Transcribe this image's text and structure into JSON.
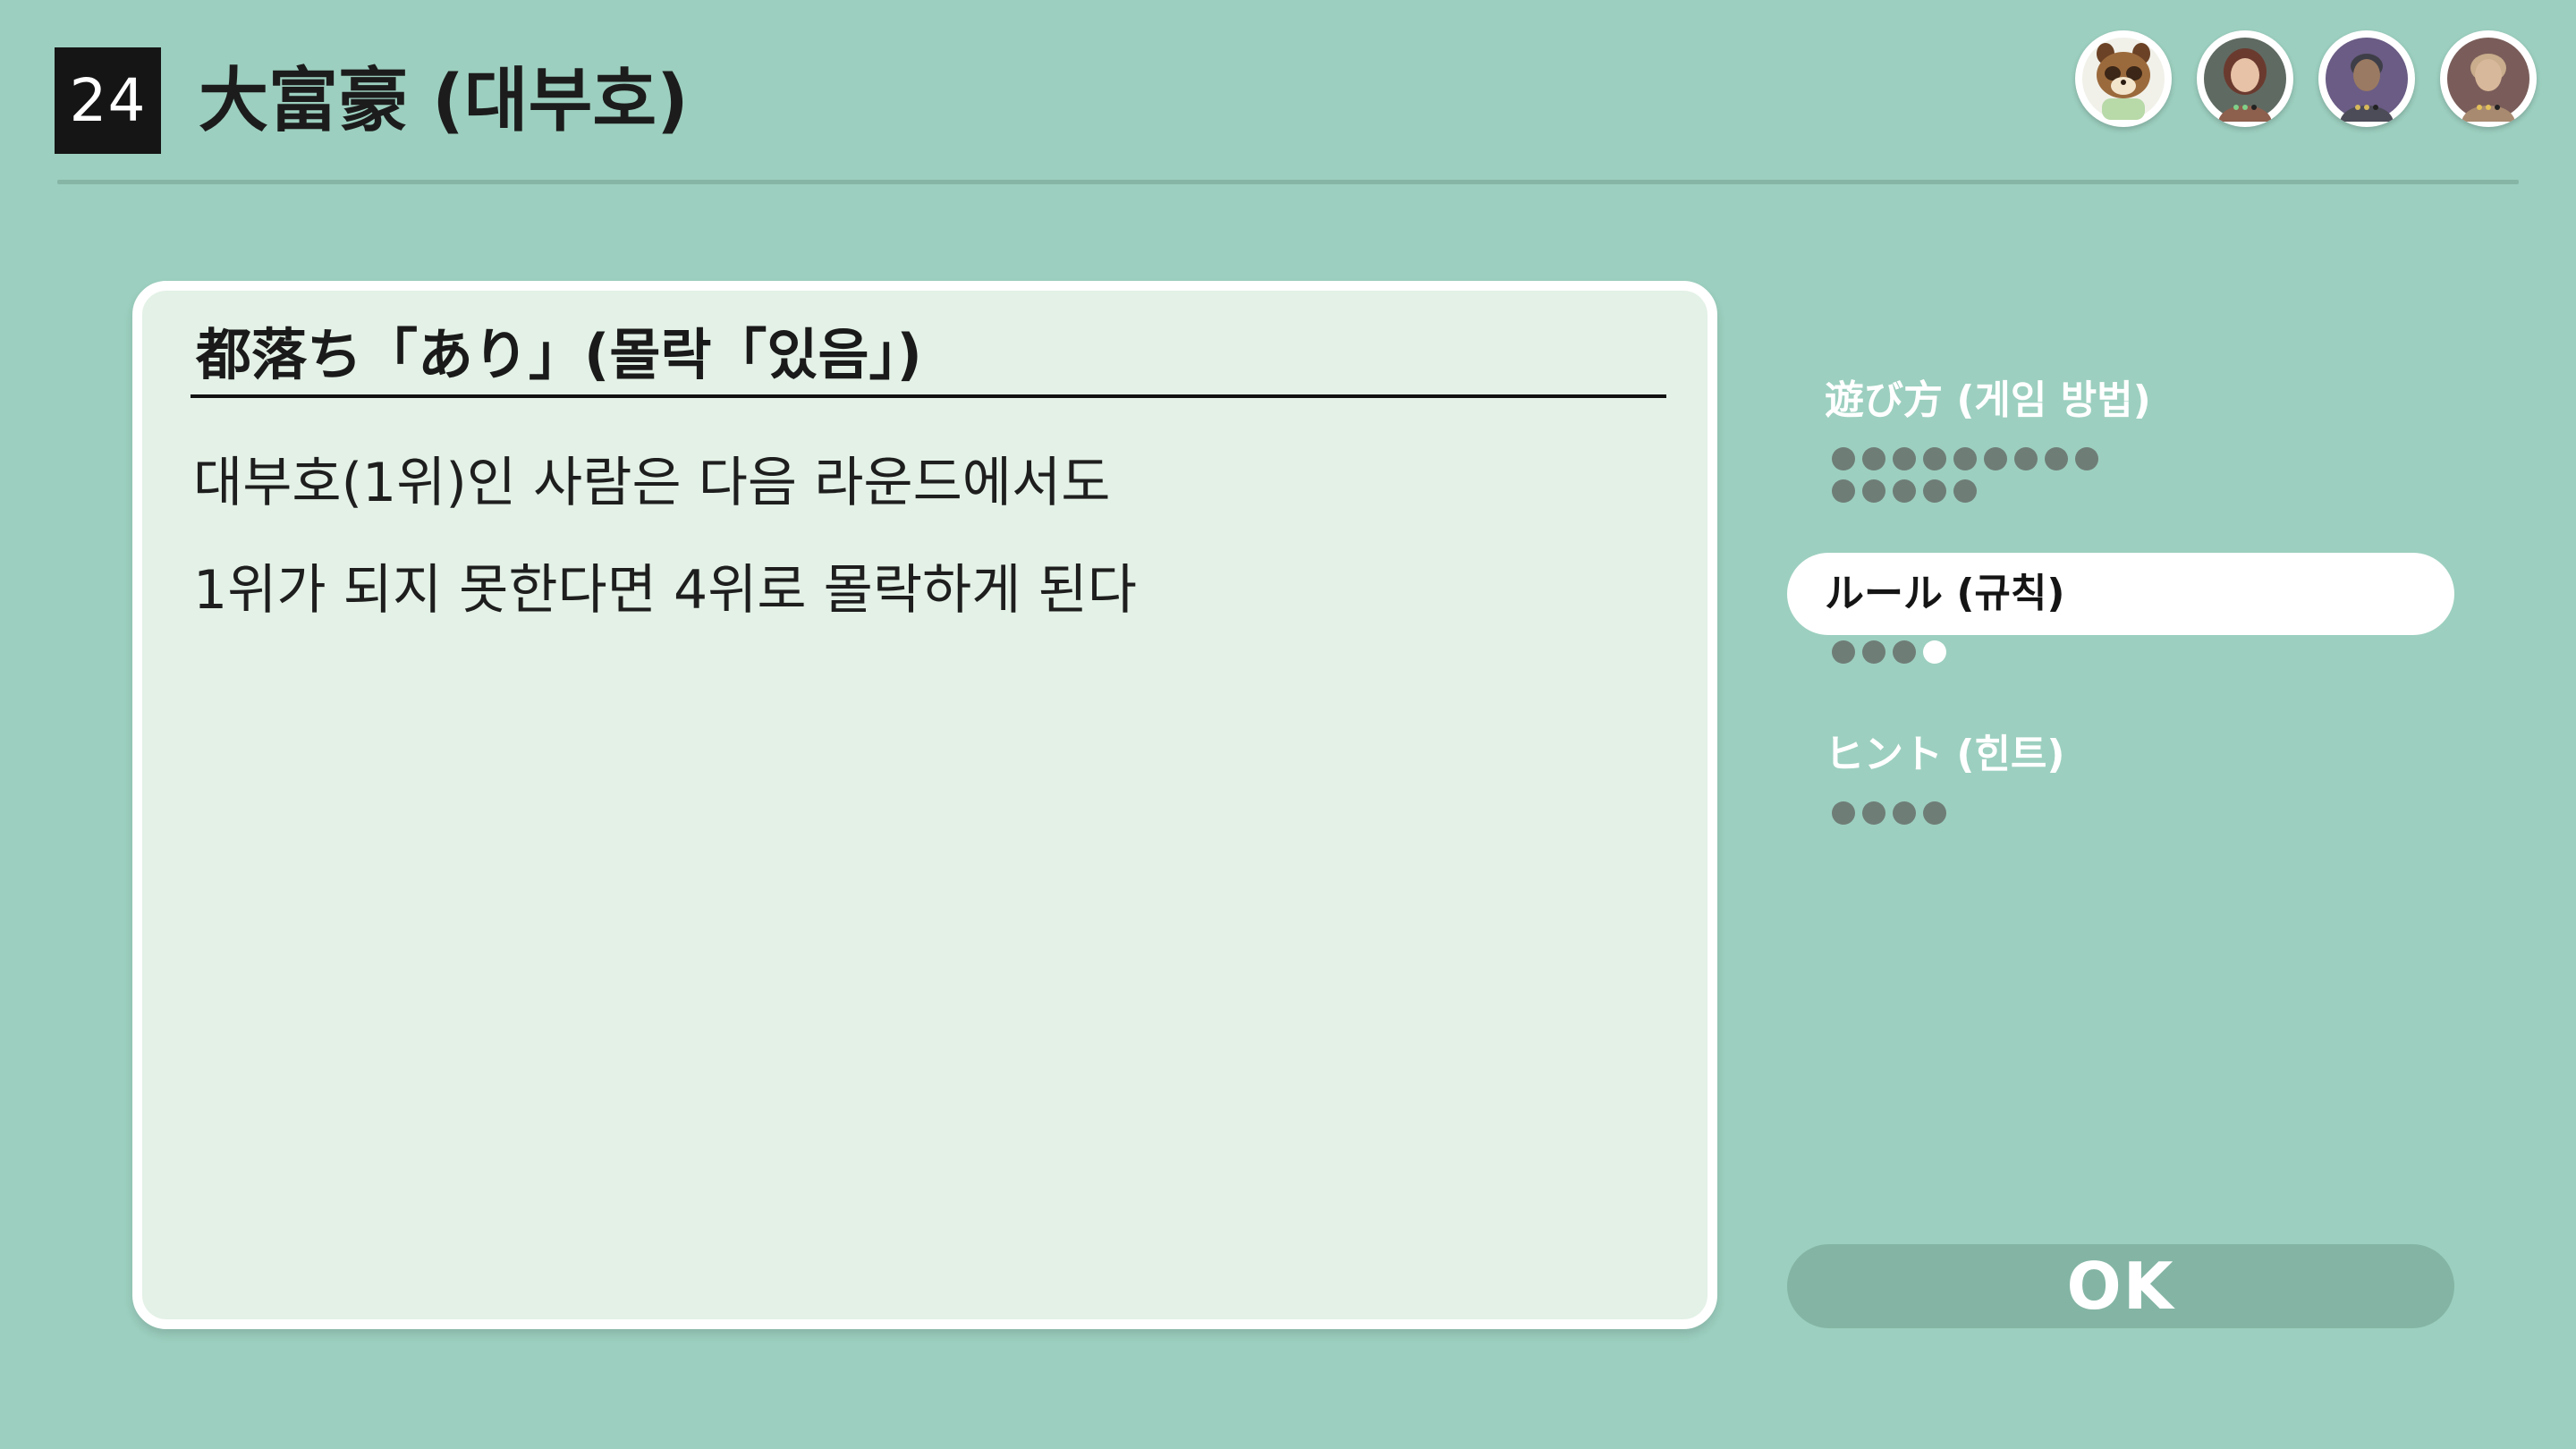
{
  "header": {
    "game_number": "24",
    "title": "大富豪 (대부호)"
  },
  "avatars": [
    {
      "name": "tanuki-avatar-icon",
      "accent": "#7a4a2a"
    },
    {
      "name": "player-avatar-icon-1",
      "accent": "#6b3a2f"
    },
    {
      "name": "player-avatar-icon-2",
      "accent": "#3e3e48"
    },
    {
      "name": "player-avatar-icon-3",
      "accent": "#a88a70"
    }
  ],
  "card": {
    "title": "都落ち「あり」(몰락「있음」)",
    "lines": [
      "대부호(1위)인 사람은 다음 라운드에서도",
      "1위가 되지 못한다면 4위로 몰락하게 된다"
    ]
  },
  "sections": [
    {
      "label": "遊び方 (게임 방법)",
      "page_count": 14,
      "current_page": null
    },
    {
      "label": "ルール (규칙)",
      "page_count": 4,
      "current_page": 4
    },
    {
      "label": "ヒント (힌트)",
      "page_count": 4,
      "current_page": null
    }
  ],
  "ok_button": {
    "label": "OK"
  },
  "colors": {
    "background": "#9ccfbf",
    "card_fill": "#e3f1e6",
    "ok_button": "#84b5a4",
    "dot": "#6f7d77"
  }
}
